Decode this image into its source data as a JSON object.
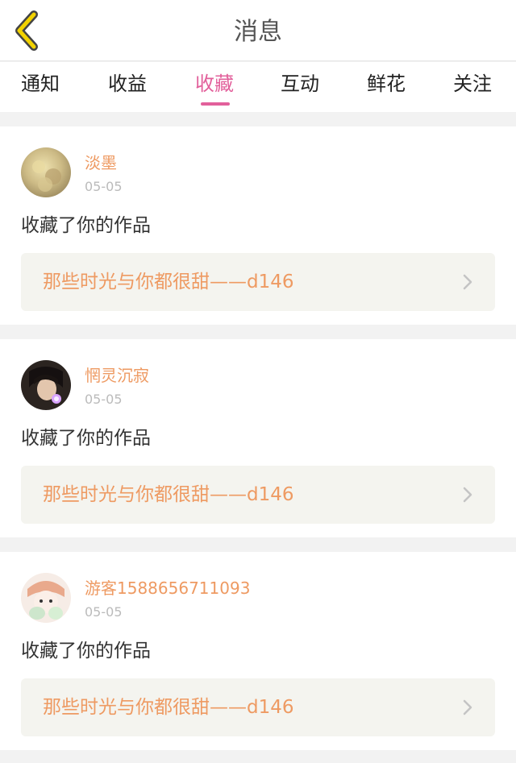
{
  "header": {
    "title": "消息",
    "back_icon": "chevron-left-icon",
    "back_icon_color": "#f2d200"
  },
  "tabs": [
    {
      "label": "通知",
      "active": false
    },
    {
      "label": "收益",
      "active": false
    },
    {
      "label": "收藏",
      "active": true
    },
    {
      "label": "互动",
      "active": false
    },
    {
      "label": "鲜花",
      "active": false
    },
    {
      "label": "关注",
      "active": false
    }
  ],
  "colors": {
    "accent": "#e2609b",
    "username": "#ee9a62",
    "work_title": "#ee9a62",
    "date": "#bbbbbb"
  },
  "messages": [
    {
      "username": "淡墨",
      "date": "05-05",
      "action": "收藏了你的作品",
      "work_title": "那些时光与你都很甜——d146"
    },
    {
      "username": "惘灵沉寂",
      "date": "05-05",
      "action": "收藏了你的作品",
      "work_title": "那些时光与你都很甜——d146"
    },
    {
      "username": "游客1588656711093",
      "date": "05-05",
      "action": "收藏了你的作品",
      "work_title": "那些时光与你都很甜——d146"
    }
  ]
}
